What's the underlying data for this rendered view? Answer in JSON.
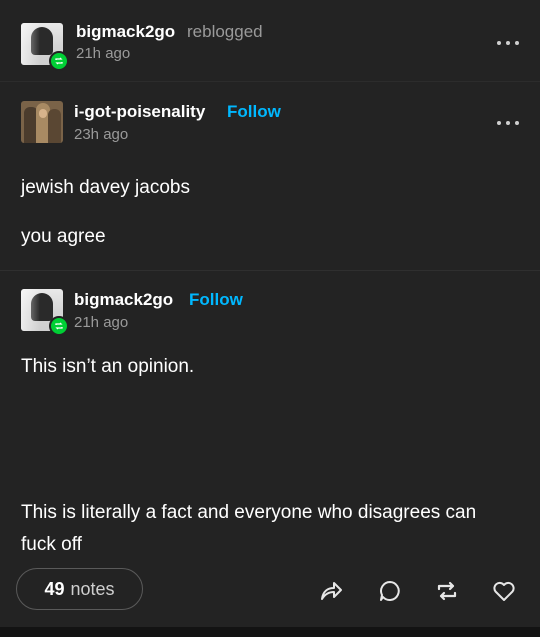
{
  "header": {
    "username": "bigmack2go",
    "action": "reblogged",
    "time": "21h ago"
  },
  "original_post": {
    "username": "i-got-poisenality",
    "follow_label": "Follow",
    "time": "23h ago",
    "lines": [
      "jewish davey jacobs",
      "you agree"
    ]
  },
  "reblog": {
    "username": "bigmack2go",
    "follow_label": "Follow",
    "time": "21h ago",
    "paragraph1": "This isn’t an opinion.",
    "paragraph2": "This is literally a fact and everyone who disagrees can fuck off"
  },
  "footer": {
    "notes_count": "49",
    "notes_label": "notes",
    "icons": [
      "share-icon",
      "reply-icon",
      "reblog-icon",
      "like-icon"
    ]
  },
  "colors": {
    "follow": "#00b8ff",
    "reblog_badge": "#00cf35",
    "card_bg": "#232323",
    "muted_text": "#9a9a9a"
  }
}
